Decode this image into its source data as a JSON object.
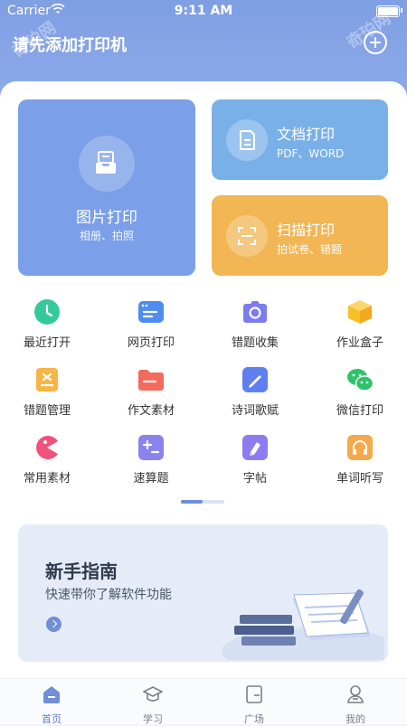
{
  "status": {
    "carrier": "Carrier",
    "time": "9:11 AM"
  },
  "header": {
    "title": "请先添加打印机",
    "add_icon": "plus-circle-icon"
  },
  "cards": {
    "photo": {
      "title": "图片打印",
      "subtitle": "相册、拍照",
      "icon": "tray-icon"
    },
    "doc": {
      "title": "文档打印",
      "subtitle": "PDF、WORD",
      "icon": "document-icon"
    },
    "scan": {
      "title": "扫描打印",
      "subtitle": "拍试卷、错题",
      "icon": "scan-icon"
    }
  },
  "grid": [
    {
      "label": "最近打开",
      "icon": "clock-icon",
      "color": "#35c99a"
    },
    {
      "label": "网页打印",
      "icon": "browser-icon",
      "color": "#4f8cf0"
    },
    {
      "label": "错题收集",
      "icon": "camera-icon",
      "color": "#7c7cf0"
    },
    {
      "label": "作业盒子",
      "icon": "box-icon",
      "color": "#f6c02a"
    },
    {
      "label": "错题管理",
      "icon": "error-manage-icon",
      "color": "#f6b546"
    },
    {
      "label": "作文素材",
      "icon": "folder-icon",
      "color": "#f36a5e"
    },
    {
      "label": "诗词歌赋",
      "icon": "pen-icon",
      "color": "#5f7ff0"
    },
    {
      "label": "微信打印",
      "icon": "wechat-icon",
      "color": "#2dc36a"
    },
    {
      "label": "常用素材",
      "icon": "pacman-icon",
      "color": "#f0527c"
    },
    {
      "label": "速算题",
      "icon": "math-icon",
      "color": "#8a82ee"
    },
    {
      "label": "字帖",
      "icon": "brush-icon",
      "color": "#8c7cf0"
    },
    {
      "label": "单词听写",
      "icon": "headphone-icon",
      "color": "#f5a94a"
    }
  ],
  "guide": {
    "title": "新手指南",
    "subtitle": "快速带你了解软件功能"
  },
  "tabs": [
    {
      "label": "首页",
      "icon": "home-icon",
      "active": true
    },
    {
      "label": "学习",
      "icon": "graduation-cap-icon",
      "active": false
    },
    {
      "label": "广场",
      "icon": "square-icon",
      "active": false
    },
    {
      "label": "我的",
      "icon": "profile-icon",
      "active": false
    }
  ],
  "colors": {
    "header": "#7f9fe3",
    "accent": "#5d7fd2",
    "photo_card": "#7b9fe8",
    "doc_card": "#7ab0e8",
    "scan_card": "#f2b654"
  }
}
